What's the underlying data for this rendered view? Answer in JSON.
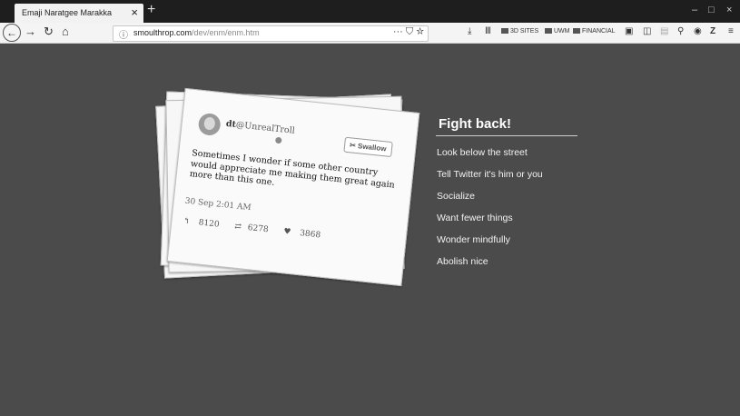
{
  "browser": {
    "tab_title": "Emaji Naratgee Marakka",
    "tab_close": "×",
    "new_tab": "+",
    "window_controls": [
      "–",
      "□",
      "×"
    ],
    "url_host": "smoulthrop.com",
    "url_path": "/dev/enm/enm.htm",
    "url_icons": "··· ⛉ ☆",
    "bookmarks": [
      "3D SITES",
      "UWM",
      "FINANCIAL"
    ]
  },
  "card": {
    "handle_prefix": "dt",
    "handle": "@UnrealTroll",
    "swallow_label": "Swallow",
    "text": "Sometimes I wonder if some other country would appreciate me making them great again more than this one.",
    "date": "30 Sep 2:01 AM",
    "replies": "8120",
    "retweets": "6278",
    "likes": "3868"
  },
  "side": {
    "title": "Fight back!",
    "links": [
      "Look below the street",
      "Tell Twitter it's him or you",
      "Socialize",
      "Want fewer things",
      "Wonder mindfully",
      "Abolish nice"
    ]
  }
}
